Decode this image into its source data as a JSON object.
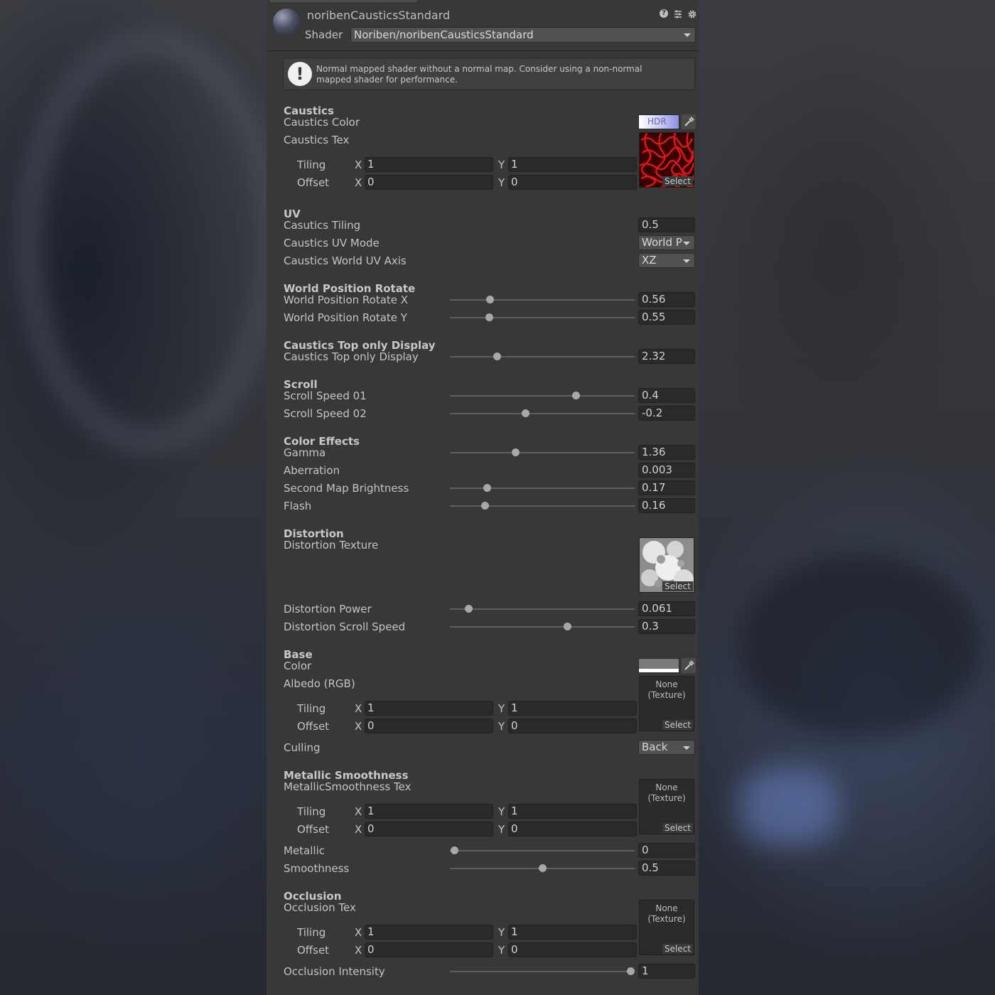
{
  "material": {
    "name": "noribenCausticsStandard",
    "shader_label": "Shader",
    "shader_value": "Noriben/noribenCausticsStandard"
  },
  "header_icons": [
    "help-icon",
    "preset-icon",
    "gear-icon"
  ],
  "warning": {
    "line1": "Normal mapped shader without a normal map. Consider using a non-normal",
    "line2": "mapped shader for performance."
  },
  "common": {
    "x": "X",
    "y": "Y",
    "select": "Select",
    "none": "None",
    "texture": "(Texture)",
    "hdr": "HDR",
    "tiling": "Tiling",
    "offset": "Offset"
  },
  "caustics": {
    "header": "Caustics",
    "color_label": "Caustics Color",
    "tex_label": "Caustics Tex",
    "tiling_x": "1",
    "tiling_y": "1",
    "offset_x": "0",
    "offset_y": "0"
  },
  "uv": {
    "header": "UV",
    "tiling_label": "Casutics Tiling",
    "tiling_value": "0.5",
    "mode_label": "Caustics UV Mode",
    "mode_value": "World P",
    "axis_label": "Caustics World UV Axis",
    "axis_value": "XZ"
  },
  "rotate": {
    "header": "World Position Rotate",
    "x_label": "World Position Rotate X",
    "x_value": "0.56",
    "x_level": 0.2,
    "y_label": "World Position Rotate Y",
    "y_value": "0.55",
    "y_level": 0.196
  },
  "toponly": {
    "header": "Caustics Top only Display",
    "label": "Caustics Top only Display",
    "value": "2.32",
    "level": 0.242
  },
  "scroll": {
    "header": "Scroll",
    "s1_label": "Scroll Speed 01",
    "s1_value": "0.4",
    "s1_level": 0.688,
    "s2_label": "Scroll Speed 02",
    "s2_value": "-0.2",
    "s2_level": 0.404
  },
  "effects": {
    "header": "Color Effects",
    "gamma_label": "Gamma",
    "gamma_value": "1.36",
    "gamma_level": 0.346,
    "aberration_label": "Aberration",
    "aberration_value": "0.003",
    "second_label": "Second Map Brightness",
    "second_value": "0.17",
    "second_level": 0.185,
    "flash_label": "Flash",
    "flash_value": "0.16",
    "flash_level": 0.173
  },
  "distortion": {
    "header": "Distortion",
    "tex_label": "Distortion Texture",
    "power_label": "Distortion Power",
    "power_value": "0.061",
    "power_level": 0.081,
    "speed_label": "Distortion Scroll Speed",
    "speed_value": "0.3",
    "speed_level": 0.642
  },
  "base": {
    "header": "Base",
    "color_label": "Color",
    "albedo_label": "Albedo (RGB)",
    "tiling_x": "1",
    "tiling_y": "1",
    "offset_x": "0",
    "offset_y": "0",
    "culling_label": "Culling",
    "culling_value": "Back"
  },
  "metallic": {
    "header": "Metallic Smoothness",
    "tex_label": "MetallicSmoothness Tex",
    "tiling_x": "1",
    "tiling_y": "1",
    "offset_x": "0",
    "offset_y": "0",
    "metallic_label": "Metallic",
    "metallic_value": "0",
    "metallic_level": 0.0,
    "smooth_label": "Smoothness",
    "smooth_value": "0.5",
    "smooth_level": 0.5
  },
  "occlusion": {
    "header": "Occlusion",
    "tex_label": "Occlusion Tex",
    "tiling_x": "1",
    "tiling_y": "1",
    "offset_x": "0",
    "offset_y": "0",
    "intensity_label": "Occlusion Intensity",
    "intensity_value": "1",
    "intensity_level": 1.0
  },
  "colors": {
    "panel": "#383838",
    "field": "#2a2a2a",
    "caustics_hdr": "#8a8fe0",
    "base_color": "#7a7a7a"
  }
}
